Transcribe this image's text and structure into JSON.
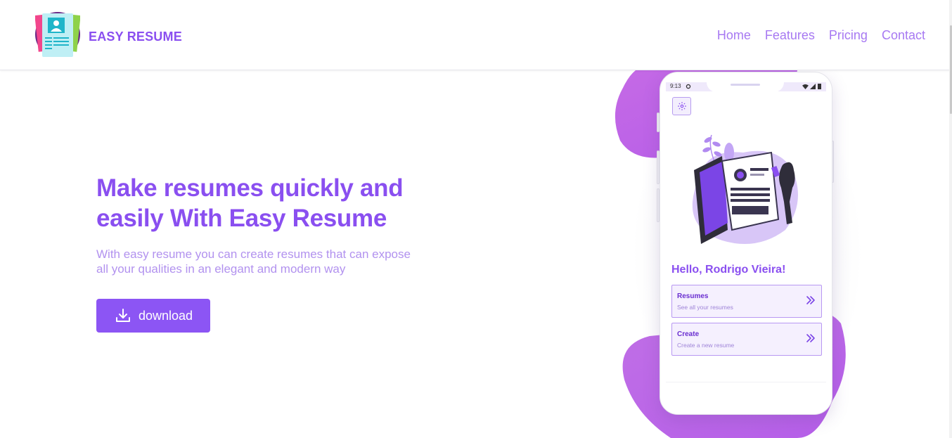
{
  "header": {
    "brand": "EASY RESUME",
    "nav": [
      "Home",
      "Features",
      "Pricing",
      "Contact"
    ]
  },
  "hero": {
    "title": "Make resumes quickly and easily With Easy Resume",
    "subtitle": "With easy resume you can create resumes that can expose all your qualities in an elegant and modern way",
    "download_label": "download"
  },
  "phone": {
    "status_time": "9:13",
    "greeting": "Hello, Rodrigo Vieira!",
    "cards": [
      {
        "title": "Resumes",
        "subtitle": "See all your resumes"
      },
      {
        "title": "Create",
        "subtitle": "Create a new resume"
      }
    ]
  },
  "colors": {
    "accent": "#8a4ff0",
    "button": "#8c55f4",
    "blob": "#b863e8",
    "nav_link": "#a779f2",
    "subtitle": "#b292ef"
  },
  "icons": [
    "logo-icon",
    "download-icon",
    "settings-icon",
    "chevron-right-double-icon",
    "wifi-icon",
    "signal-icon",
    "battery-icon"
  ]
}
